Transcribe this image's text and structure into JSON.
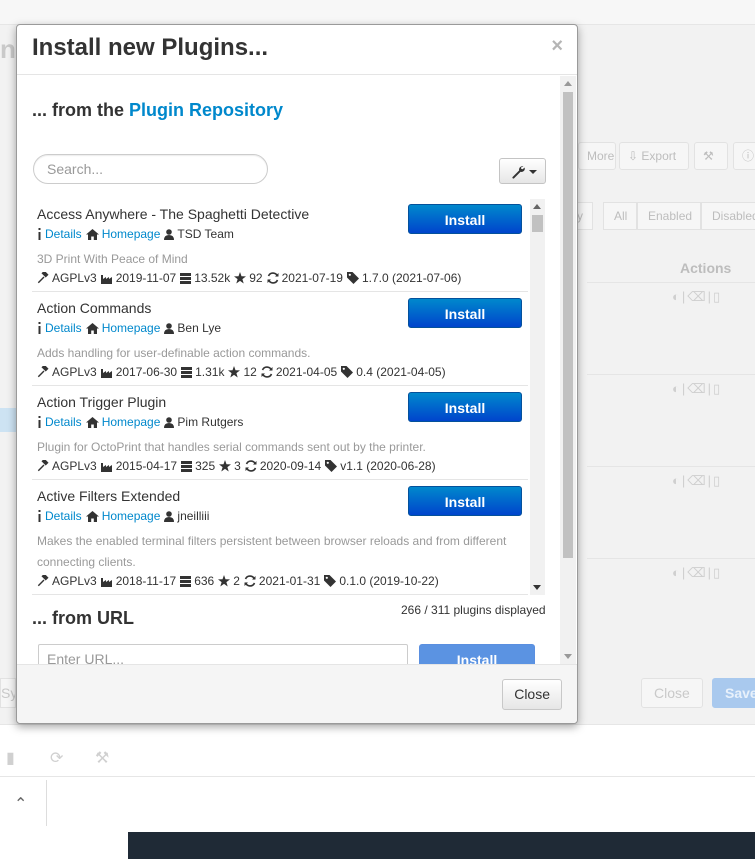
{
  "background": {
    "title_fragment": "ng",
    "toolbar": {
      "more": "More",
      "export": "Export"
    },
    "filters": [
      "y",
      "All",
      "Enabled",
      "Disabled"
    ],
    "table": {
      "actions_header": "Actions"
    },
    "footer": {
      "sys_fragment": "Sy",
      "close": "Close",
      "save": "Save"
    }
  },
  "modal": {
    "title": "Install new Plugins...",
    "close_glyph": "×",
    "repo_heading_prefix": "... from the ",
    "repo_heading_link": "Plugin Repository",
    "search": {
      "placeholder": "Search...",
      "value": ""
    },
    "plugins": [
      {
        "name": "Access Anywhere - The Spaghetti Detective",
        "install": "Install",
        "details": "Details",
        "homepage": "Homepage",
        "author": "TSD Team",
        "description": "3D Print With Peace of Mind",
        "license": "AGPLv3",
        "created": "2019-11-07",
        "downloads": "13.52k",
        "stars": "92",
        "updated": "2021-07-19",
        "version": "1.7.0 (2021-07-06)"
      },
      {
        "name": "Action Commands",
        "install": "Install",
        "details": "Details",
        "homepage": "Homepage",
        "author": "Ben Lye",
        "description": "Adds handling for user-definable action commands.",
        "license": "AGPLv3",
        "created": "2017-06-30",
        "downloads": "1.31k",
        "stars": "12",
        "updated": "2021-04-05",
        "version": "0.4 (2021-04-05)"
      },
      {
        "name": "Action Trigger Plugin",
        "install": "Install",
        "details": "Details",
        "homepage": "Homepage",
        "author": "Pim Rutgers",
        "description": "Plugin for OctoPrint that handles serial commands sent out by the printer.",
        "license": "AGPLv3",
        "created": "2015-04-17",
        "downloads": "325",
        "stars": "3",
        "updated": "2020-09-14",
        "version": "v1.1 (2020-06-28)"
      },
      {
        "name": "Active Filters Extended",
        "install": "Install",
        "details": "Details",
        "homepage": "Homepage",
        "author": "jneilliii",
        "description": "Makes the enabled terminal filters persistent between browser reloads and from different connecting clients.",
        "license": "AGPLv3",
        "created": "2018-11-17",
        "downloads": "636",
        "stars": "2",
        "updated": "2021-01-31",
        "version": "0.1.0 (2019-10-22)"
      }
    ],
    "plugin_count": "266 / 311 plugins displayed",
    "url_heading": "... from URL",
    "url": {
      "placeholder": "Enter URL...",
      "value": "",
      "install": "Install"
    },
    "footer_close": "Close"
  },
  "colors": {
    "link": "#0088cc",
    "install_button": "#0055cc",
    "install_button_disabled": "#5b93e2"
  }
}
